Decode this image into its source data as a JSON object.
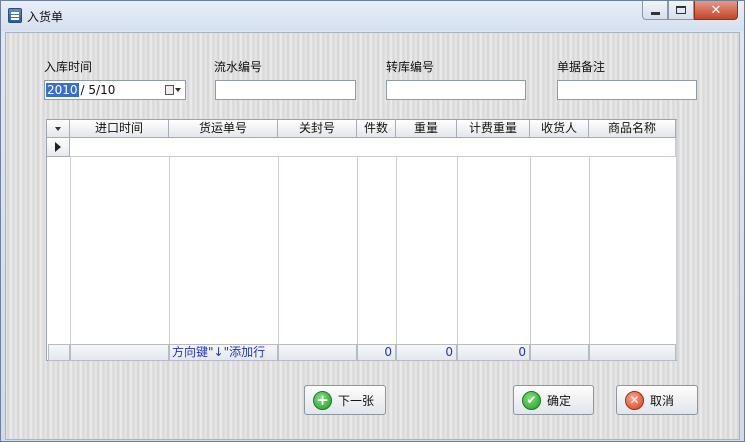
{
  "window": {
    "title": "入货单",
    "close_glyph": "✕"
  },
  "form": {
    "date_label": "入库时间",
    "date_year": "2010",
    "date_rest": "/  5/10",
    "serial_label": "流水编号",
    "serial_value": "",
    "transfer_label": "转库编号",
    "transfer_value": "",
    "remark_label": "单据备注",
    "remark_value": ""
  },
  "grid": {
    "columns": [
      "进口时间",
      "货运单号",
      "关封号",
      "件数",
      "重量",
      "计费重量",
      "收货人",
      "商品名称"
    ],
    "footer": [
      "",
      "方向键\"↓\"添加行",
      "",
      "0",
      "0",
      "0",
      "",
      ""
    ]
  },
  "buttons": {
    "next_label": "下一张",
    "next_icon": "plus-circle-icon",
    "confirm_label": "确定",
    "confirm_icon": "check-circle-icon",
    "cancel_label": "取消",
    "cancel_icon": "x-circle-icon",
    "plus_glyph": "+",
    "check_glyph": "✔",
    "x_glyph": "✕"
  }
}
